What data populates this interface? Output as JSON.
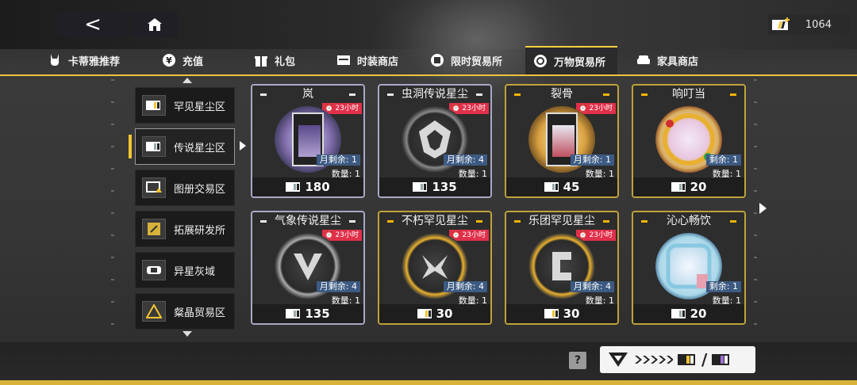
{
  "header": {
    "back_label": "<",
    "currency_value": "1064"
  },
  "tabs": [
    {
      "label": "卡蒂雅推荐",
      "icon": "bunny-icon"
    },
    {
      "label": "充值",
      "icon": "yen-icon"
    },
    {
      "label": "礼包",
      "icon": "gift-icon"
    },
    {
      "label": "时装商店",
      "icon": "wardrobe-icon"
    },
    {
      "label": "限时贸易所",
      "icon": "shop-icon"
    },
    {
      "label": "万物贸易所",
      "icon": "cycle-icon",
      "active": true
    },
    {
      "label": "家具商店",
      "icon": "sofa-icon"
    }
  ],
  "sidebar": {
    "items": [
      {
        "label": "罕见星尘区"
      },
      {
        "label": "传说星尘区",
        "active": true
      },
      {
        "label": "图册交易区"
      },
      {
        "label": "拓展研发所"
      },
      {
        "label": "异星灰域"
      },
      {
        "label": "粲晶贸易区"
      }
    ]
  },
  "cards": [
    {
      "title": "岚",
      "timer": "23小时",
      "stock": "月剩余: 1",
      "qty": "数量: 1",
      "price": "180",
      "frame": "silver"
    },
    {
      "title": "虫洞传说星尘",
      "timer": "23小时",
      "stock": "月剩余: 4",
      "qty": "数量: 1",
      "price": "135",
      "frame": "silver"
    },
    {
      "title": "裂骨",
      "timer": "23小时",
      "stock": "月剩余: 1",
      "qty": "数量: 1",
      "price": "45",
      "frame": "gold"
    },
    {
      "title": "响叮当",
      "timer": "",
      "stock": "剩余: 1",
      "qty": "数量: 1",
      "price": "20",
      "frame": "gold"
    },
    {
      "title": "气象传说星尘",
      "timer": "23小时",
      "stock": "月剩余: 4",
      "qty": "数量: 1",
      "price": "135",
      "frame": "silver"
    },
    {
      "title": "不朽罕见星尘",
      "timer": "23小时",
      "stock": "月剩余: 4",
      "qty": "数量: 1",
      "price": "30",
      "frame": "gold"
    },
    {
      "title": "乐团罕见星尘",
      "timer": "23小时",
      "stock": "月剩余: 4",
      "qty": "数量: 1",
      "price": "30",
      "frame": "gold"
    },
    {
      "title": "沁心畅饮",
      "timer": "",
      "stock": "剩余: 1",
      "qty": "数量: 1",
      "price": "20",
      "frame": "gold"
    }
  ],
  "footer": {
    "help_label": "?",
    "exchange_divider": "/"
  }
}
